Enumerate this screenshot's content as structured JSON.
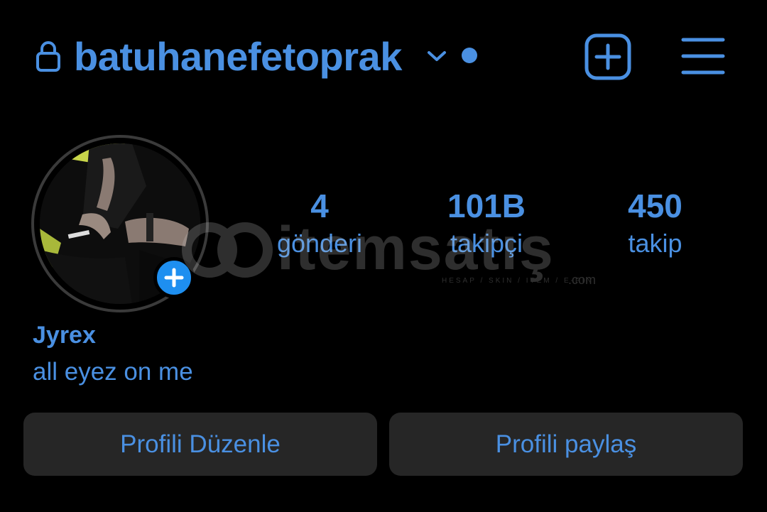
{
  "header": {
    "username": "batuhanefetoprak",
    "lock_icon": "lock-icon",
    "chevron_icon": "chevron-down-icon",
    "notification_dot_icon": "dot-icon",
    "new_post_icon": "plus-square-icon",
    "menu_icon": "hamburger-menu-icon"
  },
  "profile": {
    "avatar_icon": "add-story-plus-icon",
    "stats": [
      {
        "count": "4",
        "label": "gönderi"
      },
      {
        "count": "101B",
        "label": "takipçi"
      },
      {
        "count": "450",
        "label": "takip"
      }
    ],
    "display_name": "Jyrex",
    "bio": "all eyez on me"
  },
  "actions": {
    "edit_profile": "Profili Düzenle",
    "share_profile": "Profili paylaş"
  },
  "watermark": {
    "brand": "itemsatış",
    "tagline": "HESAP / SKIN / ITEM / E-PIN",
    "domain": ".com"
  },
  "colors": {
    "accent": "#4a90e2",
    "background": "#000000",
    "button_bg": "#262626",
    "story_plus": "#1e8ff0"
  }
}
